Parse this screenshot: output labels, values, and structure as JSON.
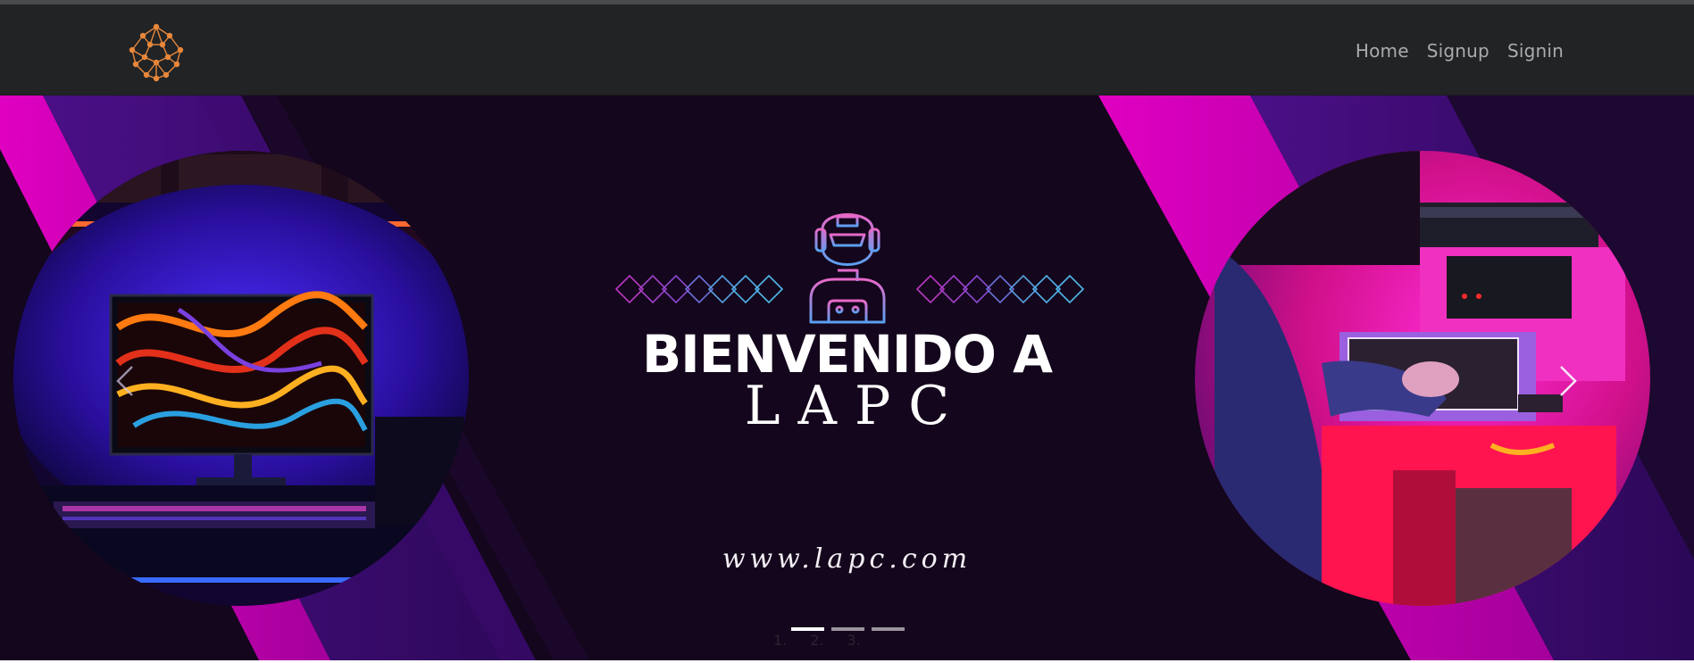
{
  "nav": {
    "logo_icon": "network-brain-icon",
    "links": [
      {
        "label": "Home"
      },
      {
        "label": "Signup"
      },
      {
        "label": "Signin"
      }
    ]
  },
  "hero": {
    "title_line1": "BIENVENIDO A",
    "title_line2": "LAPC",
    "url": "www.lapc.com",
    "mascot_icon": "gamer-headset-icon",
    "indicators": [
      {
        "label": "1.",
        "active": true
      },
      {
        "label": "2.",
        "active": false
      },
      {
        "label": "3.",
        "active": false
      }
    ],
    "prev_icon": "chevron-left-icon",
    "next_icon": "chevron-right-icon"
  },
  "colors": {
    "navbar": "#212325",
    "hero_bg": "#14061c",
    "magenta": "#c800b4",
    "purple": "#3b0a6e",
    "logo": "#e8873a"
  }
}
